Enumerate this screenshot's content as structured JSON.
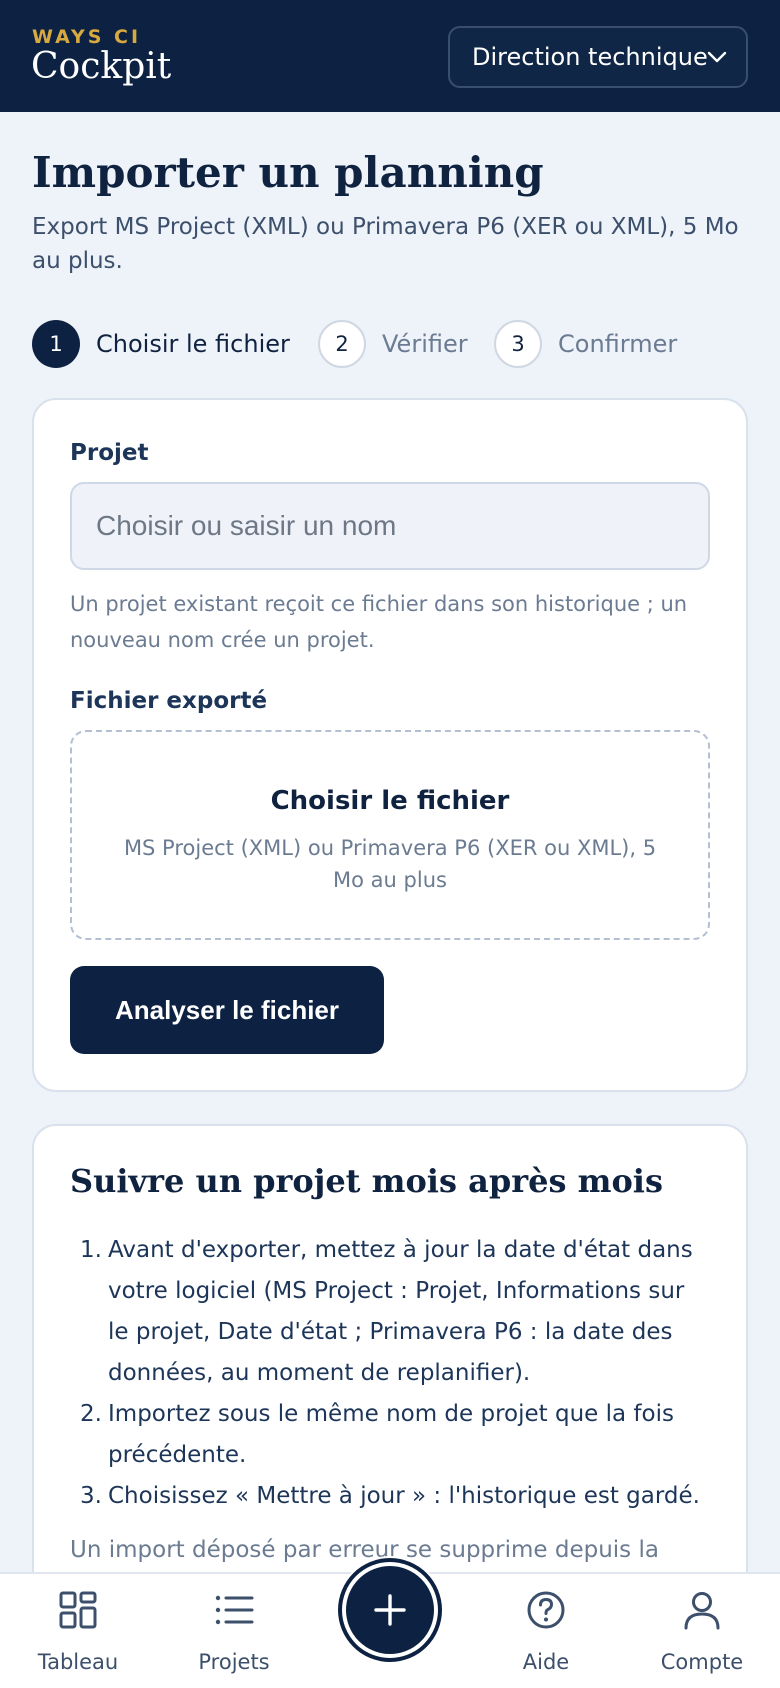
{
  "header": {
    "brand_small": "WAYS CI",
    "brand_name": "Cockpit",
    "org_selector": "Direction technique"
  },
  "page": {
    "title": "Importer un planning",
    "subtitle": "Export MS Project (XML) ou Primavera P6 (XER ou XML), 5 Mo au plus."
  },
  "steps": [
    {
      "number": "1",
      "label": "Choisir le fichier",
      "state": "active"
    },
    {
      "number": "2",
      "label": "Vérifier",
      "state": "idle"
    },
    {
      "number": "3",
      "label": "Confirmer",
      "state": "idle"
    }
  ],
  "form": {
    "project_label": "Projet",
    "project_placeholder": "Choisir ou saisir un nom",
    "project_value": "",
    "project_hint": "Un projet existant reçoit ce fichier dans son historique ; un nouveau nom crée un projet.",
    "file_label": "Fichier exporté",
    "dropzone_title": "Choisir le fichier",
    "dropzone_sub": "MS Project (XML) ou Primavera P6 (XER ou XML), 5 Mo au plus",
    "analyze_button": "Analyser le fichier"
  },
  "howto": {
    "title": "Suivre un projet mois après mois",
    "items": [
      {
        "num": "1.",
        "text": "Avant d'exporter, mettez à jour la date d'état dans votre logiciel (MS Project : Projet, Informations sur le projet, Date d'état ; Primavera P6 : la date des données, au moment de replanifier)."
      },
      {
        "num": "2.",
        "text": "Importez sous le même nom de projet que la fois précédente."
      },
      {
        "num": "3.",
        "text": "Choisissez « Mettre à jour » : l'historique est gardé."
      }
    ],
    "note": "Un import déposé par erreur se supprime depuis la"
  },
  "bottom_nav": {
    "dashboard": "Tableau",
    "projects": "Projets",
    "help": "Aide",
    "account": "Compte"
  },
  "colors": {
    "navy": "#0d2242",
    "gold": "#d8a93f",
    "background": "#eef2f9",
    "muted": "#6b7b91"
  }
}
